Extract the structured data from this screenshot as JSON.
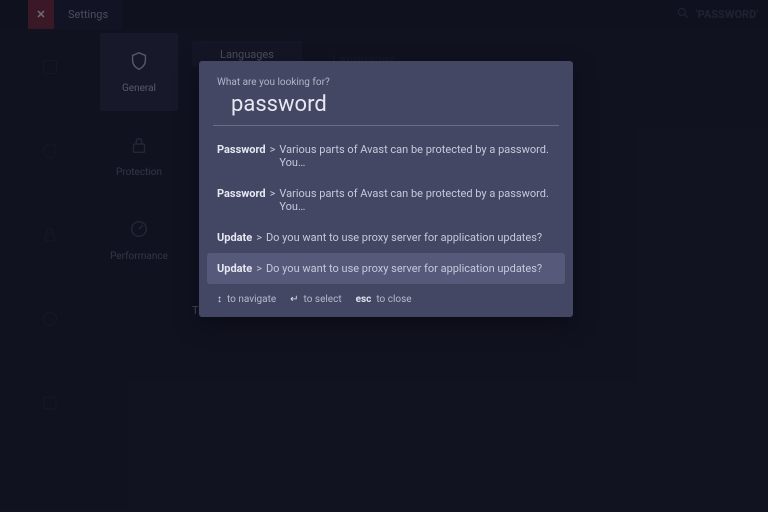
{
  "topbar": {
    "tab1": "",
    "settings_label": "Settings",
    "search_placeholder": "'PASSWORD'"
  },
  "left_nav": {
    "items": [
      {
        "label": ""
      },
      {
        "label": ""
      },
      {
        "label": ""
      },
      {
        "label": ""
      },
      {
        "label": ""
      }
    ]
  },
  "side_tiles": {
    "items": [
      {
        "label": "General"
      },
      {
        "label": "Protection"
      },
      {
        "label": "Performance"
      }
    ]
  },
  "subtabs": {
    "items": [
      {
        "label": "Languages"
      }
    ]
  },
  "ghost_header": "Languages",
  "ghost_section": "",
  "ghost_section2": "Troubleshooting",
  "modal": {
    "prompt": "What are you looking for?",
    "query": "password",
    "results": [
      {
        "key": "Password",
        "text": "Various parts of Avast can be protected by a password. You…"
      },
      {
        "key": "Password",
        "text": "Various parts of Avast can be protected by a password. You…"
      },
      {
        "key": "Update",
        "text": "Do you want to use proxy server for application updates?"
      },
      {
        "key": "Update",
        "text": "Do you want to use proxy server for application updates?"
      }
    ],
    "highlight_index": 3,
    "hints": {
      "navigate": "to navigate",
      "select": "to select",
      "close": "to close",
      "esc": "esc"
    }
  }
}
